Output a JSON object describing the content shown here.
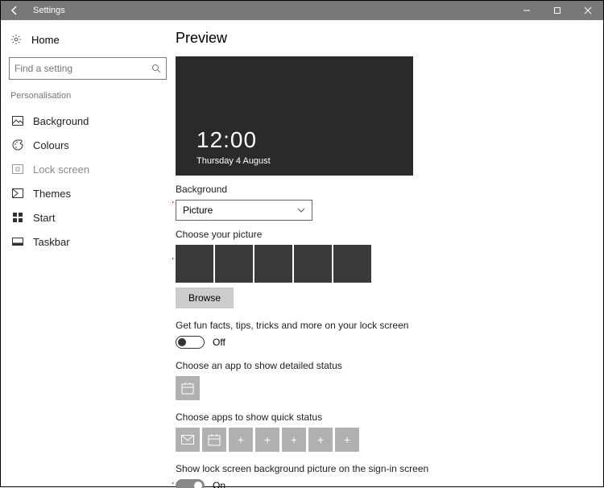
{
  "window": {
    "title": "Settings"
  },
  "sidebar": {
    "home": "Home",
    "search_placeholder": "Find a setting",
    "section": "Personalisation",
    "items": [
      {
        "label": "Background"
      },
      {
        "label": "Colours"
      },
      {
        "label": "Lock screen"
      },
      {
        "label": "Themes"
      },
      {
        "label": "Start"
      },
      {
        "label": "Taskbar"
      }
    ]
  },
  "main": {
    "preview_heading": "Preview",
    "preview_time": "12:00",
    "preview_date": "Thursday 4 August",
    "background_label": "Background",
    "background_value": "Picture",
    "choose_picture_label": "Choose your picture",
    "browse_label": "Browse",
    "fun_facts_label": "Get fun facts, tips, tricks and more on your lock screen",
    "fun_facts_value": "Off",
    "detailed_status_label": "Choose an app to show detailed status",
    "quick_status_label": "Choose apps to show quick status",
    "signin_bg_label": "Show lock screen background picture on the sign-in screen",
    "signin_bg_value": "On"
  }
}
